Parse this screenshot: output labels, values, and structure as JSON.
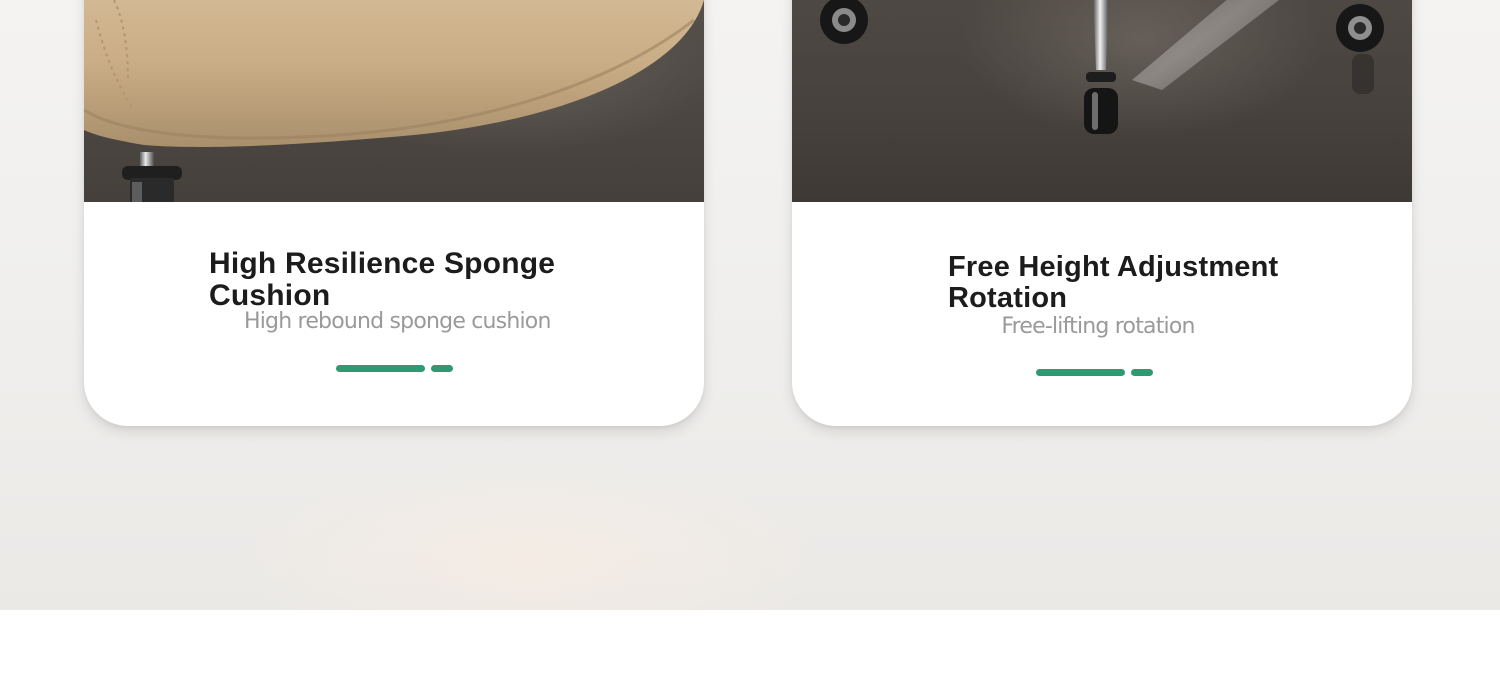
{
  "cards": [
    {
      "title": "High Resilience Sponge Cushion",
      "subtitle": "High rebound sponge cushion",
      "photo_icon": "chair-seat-cushion-photo"
    },
    {
      "title": "Free Height Adjustment Rotation",
      "subtitle": "Free-lifting rotation",
      "photo_icon": "chair-base-casters-photo"
    }
  ],
  "colors": {
    "accent": "#2f9a72",
    "title": "#1c1c1c",
    "subtitle": "#9a9a9a",
    "seat_leather": "#cdb28c",
    "floor": "#4d4843"
  }
}
